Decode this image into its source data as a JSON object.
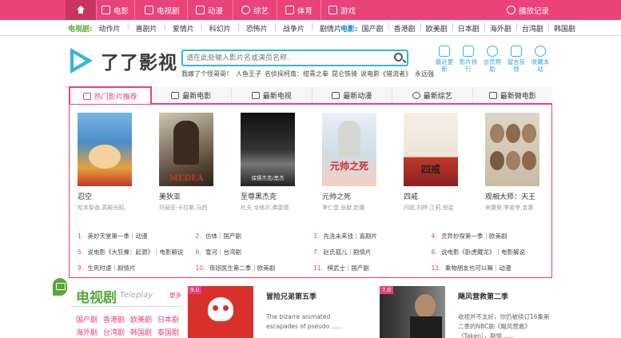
{
  "topnav": {
    "items": [
      {
        "label": "电影",
        "icon": "film-icon"
      },
      {
        "label": "电视剧",
        "icon": "tv-icon"
      },
      {
        "label": "动漫",
        "icon": "anime-icon"
      },
      {
        "label": "综艺",
        "icon": "variety-icon"
      },
      {
        "label": "体育",
        "icon": "trophy-icon"
      },
      {
        "label": "游戏",
        "icon": "gamepad-icon"
      }
    ],
    "history": "播放记录",
    "bg_color": "#e9437a"
  },
  "subnav": {
    "tv_label": "电视剧:",
    "tv_items": [
      "动作片",
      "喜剧片",
      "爱情片",
      "科幻片",
      "恐怖片",
      "战争片",
      "剧情片"
    ],
    "movie_label": "电影:",
    "movie_items": [
      "国产剧",
      "香港剧",
      "欧美剧",
      "日本剧",
      "海外剧",
      "台湾剧",
      "韩国剧"
    ]
  },
  "brand": {
    "name": "了了影视"
  },
  "search": {
    "placeholder": "请在此处输入影片名或演员名称."
  },
  "hotwords": [
    "我嫁了个怪哥哥！",
    "人鱼王子",
    "名侦探柯南：绀青之拳",
    "昆仑铁骑",
    "说电影《猎流者》",
    "永远强"
  ],
  "quicklinks": [
    {
      "label": "最近更新"
    },
    {
      "label": "影片排行"
    },
    {
      "label": "会员帮助"
    },
    {
      "label": "留言反馈"
    },
    {
      "label": "收藏本站"
    }
  ],
  "tabs": [
    {
      "label": "热门影片推荐"
    },
    {
      "label": "最新电影"
    },
    {
      "label": "最新电视"
    },
    {
      "label": "最新动漫"
    },
    {
      "label": "最新综艺"
    },
    {
      "label": "最新微电影"
    }
  ],
  "movies": [
    {
      "title": "忍空",
      "cast": "松本梨香,真殿光昭,",
      "poster_text": ""
    },
    {
      "title": "美狄亚",
      "cast": "玛丽亚·卡拉斯,马西",
      "poster_text": "MEDEA"
    },
    {
      "title": "至尊黑杰克",
      "cast": "杜夫·龙格尔,弗雷德",
      "poster_text": "保镖杰克/黑杰"
    },
    {
      "title": "元帅之死",
      "cast": "李仁堂,张献,赵娜",
      "poster_text": "元帅之死"
    },
    {
      "title": "四戒",
      "cast": "闫妮,刘桦,江莉,倪星",
      "poster_text": "四戒"
    },
    {
      "title": "观相大师：天王",
      "cast": "宋康昊,李政宰,金惠",
      "poster_text": ""
    }
  ],
  "toplist": [
    [
      "1. 美妙天堂第一季｜动漫",
      "2. 仿体｜国产剧",
      "3. 先洗未来钱｜喜剧片",
      "4. 灵异妙探第一季｜欧美剧"
    ],
    [
      "5. 说电影《大狂蜂：起源》｜电影解说",
      "6. 雪河｜台湾剧",
      "7. 赵氏孤儿｜剧情片",
      "8. 说电影《卧虎藏龙》｜电影解说"
    ],
    [
      "9. 生死时速｜剧情片",
      "10. 夜班医生第二季｜欧美剧",
      "11. 棋武士｜国产剧",
      "12. 乘物朋友也可以嘛｜动漫"
    ]
  ],
  "tv_section": {
    "title": "电视剧",
    "subtitle": "Teleplay",
    "more": "更多",
    "categories": [
      "国产剧",
      "香港剧",
      "欧美剧",
      "日本剧",
      "海外剧",
      "台湾剧",
      "韩国剧",
      "泰国剧"
    ]
  },
  "cards": [
    {
      "score": "9.0",
      "title": "冒险兄弟第五季",
      "desc": "The bizarre animated escapades of pseudo ......"
    },
    {
      "score": "7.0",
      "title": "飓风营救第二季",
      "desc": "收视并不太好，你仍被续订16集第二季的NBC剧《飓风营救》（Taken），剧情......"
    }
  ]
}
